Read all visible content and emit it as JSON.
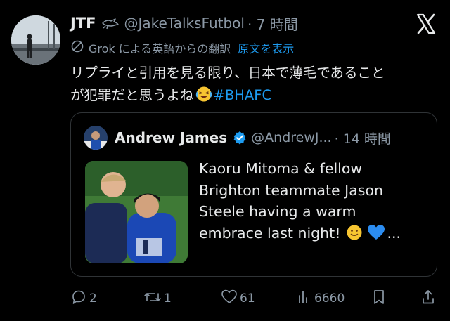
{
  "tweet": {
    "author_name": "JTF",
    "handle": "@JakeTalksFutbol",
    "time": "· 7 時間",
    "translation": {
      "label": "Grok による英語からの翻訳",
      "show_original": "原文を表示"
    },
    "body_line1": "リプライと引用を見る限り、日本で薄毛であること",
    "body_line2": "が犯罪だと思うよね",
    "hashtag": "#BHAFC"
  },
  "quote": {
    "author_name": "Andrew James",
    "handle": "@AndrewJ...",
    "time": "· 14 時間",
    "text_lines": [
      "Kaoru Mitoma & fellow",
      "Brighton teammate Jason",
      "Steele having a warm",
      "embrace last night!"
    ],
    "text_suffix": "..."
  },
  "actions": {
    "replies": "2",
    "reposts": "1",
    "likes": "61",
    "views": "6660"
  },
  "icons": {
    "bird": "bird-icon",
    "x_logo": "x-logo-icon",
    "grok": "grok-icon",
    "verified": "verified-badge-icon",
    "reply": "reply-icon",
    "repost": "repost-icon",
    "like": "heart-icon",
    "views": "views-icon",
    "bookmark": "bookmark-icon",
    "share": "share-icon"
  },
  "colors": {
    "accent": "#1d9bf0",
    "muted": "#8b98a5",
    "text": "#e7e9ea",
    "background": "#000000",
    "border": "#2f3336"
  }
}
